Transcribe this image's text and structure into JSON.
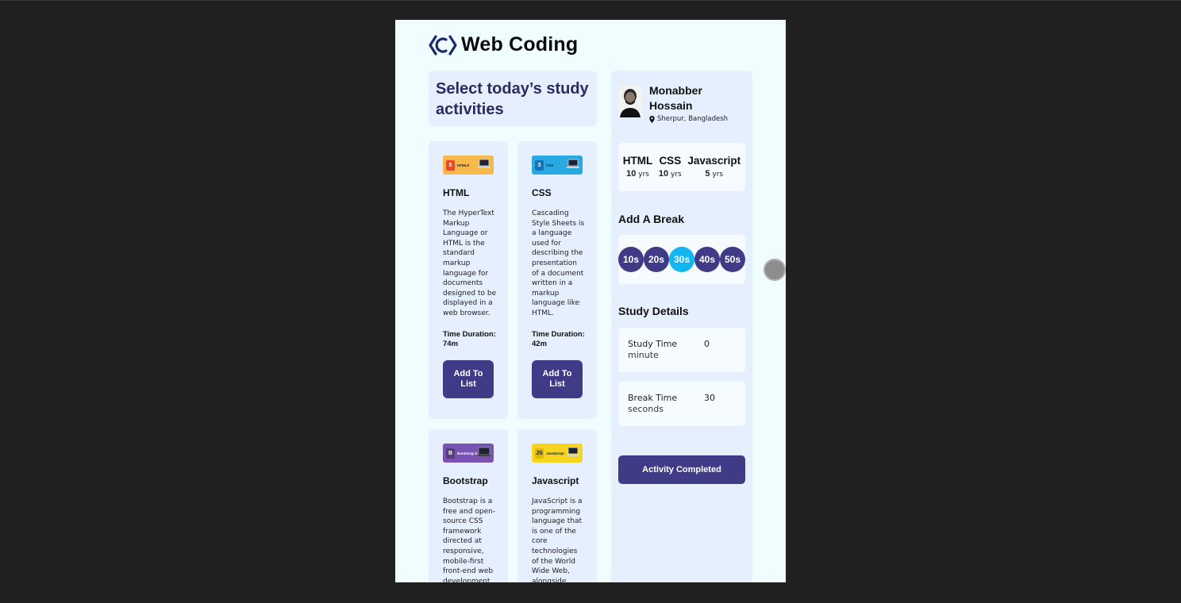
{
  "brand": {
    "name": "Web Coding"
  },
  "main": {
    "heading": "Select today’s study activities",
    "cards": [
      {
        "title": "HTML",
        "thumb_label": "HTML5",
        "badge": "5",
        "thumb_color": "#f7b94a",
        "badge_color": "#e44d26",
        "description": "The HyperText Markup Language or HTML is the standard markup language for documents designed to be displayed in a web browser.",
        "time_label": "Time Duration:",
        "time_value": "74m",
        "button": "Add To List"
      },
      {
        "title": "CSS",
        "thumb_label": "CSS",
        "badge": "3",
        "thumb_color": "#29a9e1",
        "badge_color": "#1572b6",
        "description": "Cascading Style Sheets is a language used for describing the presentation of a document written in a markup language like HTML.",
        "time_label": "Time Duration:",
        "time_value": "42m",
        "button": "Add To List"
      },
      {
        "title": "Bootstrap",
        "thumb_label": "Bootstrap 5",
        "badge": "B",
        "thumb_color": "#7952b3",
        "badge_color": "#563d7c",
        "description": "Bootstrap is a free and open-source CSS framework directed at responsive, mobile-first front-end web development."
      },
      {
        "title": "Javascript",
        "thumb_label": "JavaScript",
        "badge": "JS",
        "thumb_color": "#f7d51e",
        "badge_color": "#e0b800",
        "description": "JavaScript is a programming language that is one of the core technologies of the World Wide Web, alongside"
      }
    ]
  },
  "profile": {
    "name": "Monabber Hossain",
    "location": "Sherpur, Bangladesh",
    "skills": [
      {
        "name": "HTML",
        "years": "10",
        "unit": "yrs"
      },
      {
        "name": "CSS",
        "years": "10",
        "unit": "yrs"
      },
      {
        "name": "Javascript",
        "years": "5",
        "unit": "yrs"
      }
    ]
  },
  "break_section": {
    "title": "Add A Break",
    "options": [
      "10s",
      "20s",
      "30s",
      "40s",
      "50s"
    ],
    "selected": "30s"
  },
  "study_details": {
    "title": "Study Details",
    "study_time": {
      "label": "Study Time",
      "value": "0",
      "unit": "minute"
    },
    "break_time": {
      "label": "Break Time",
      "value": "30",
      "unit": "seconds"
    }
  },
  "complete_button": "Activity Completed",
  "colors": {
    "accent": "#3f3b86",
    "selected": "#14b6f2",
    "heading": "#2b2a63"
  }
}
